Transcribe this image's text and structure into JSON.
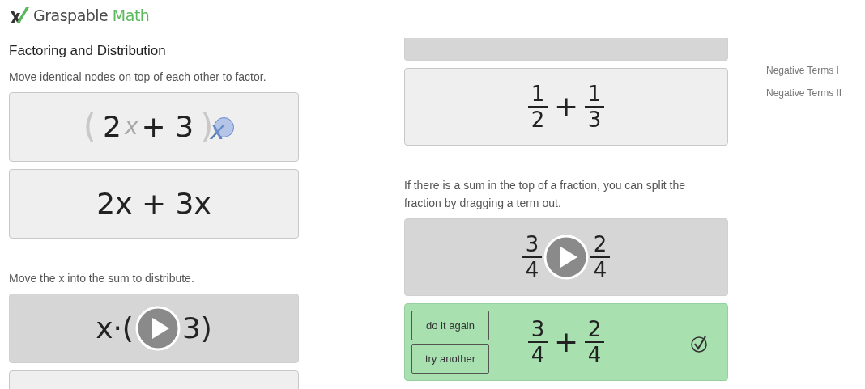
{
  "logo": {
    "word_1": "Graspable",
    "word_2": "Math"
  },
  "left_column": [
    {
      "kind": "heading",
      "text": "Factoring and Distribution"
    },
    {
      "kind": "text",
      "text": "Move identical nodes on top of each other to factor."
    },
    {
      "kind": "card",
      "math": [
        {
          "kind": "faint",
          "text": "("
        },
        {
          "kind": "sym",
          "text": "2"
        },
        {
          "kind": "ghost",
          "text": "x"
        },
        {
          "kind": "sym",
          "text": "+ 3"
        },
        {
          "kind": "faint",
          "text": ")"
        },
        {
          "kind": "dragged",
          "text": "x"
        }
      ]
    },
    {
      "kind": "card",
      "math": [
        {
          "kind": "sym",
          "text": "2x + 3x"
        }
      ]
    },
    {
      "kind": "text",
      "text": "Move the x into the sum to distribute."
    },
    {
      "kind": "video_card",
      "math": [
        {
          "kind": "sym",
          "text": "x·("
        },
        {
          "kind": "play"
        },
        {
          "kind": "sym",
          "text": "3)"
        }
      ]
    },
    {
      "kind": "bottom_cut_card"
    }
  ],
  "right_column": [
    {
      "kind": "top_cut_video_card"
    },
    {
      "kind": "card",
      "math": [
        {
          "kind": "frac",
          "num": "1",
          "den": "2"
        },
        {
          "kind": "sym",
          "text": "+"
        },
        {
          "kind": "frac",
          "num": "1",
          "den": "3"
        }
      ]
    },
    {
      "kind": "text",
      "text": "If there is a sum in the top of a fraction, you can split the fraction by dragging a term out."
    },
    {
      "kind": "video_card",
      "math": [
        {
          "kind": "frac",
          "num": "3",
          "den": "4"
        },
        {
          "kind": "play"
        },
        {
          "kind": "frac",
          "num": "2",
          "den": "4"
        }
      ]
    },
    {
      "kind": "solved_card",
      "buttons": [
        "do it again",
        "try another"
      ],
      "checked": true,
      "math": [
        {
          "kind": "frac",
          "num": "3",
          "den": "4"
        },
        {
          "kind": "sym",
          "text": "+"
        },
        {
          "kind": "frac",
          "num": "2",
          "den": "4"
        }
      ]
    }
  ],
  "sidebar": {
    "items": [
      {
        "label": "Negative Terms I"
      },
      {
        "label": "Negative Terms II"
      }
    ]
  }
}
